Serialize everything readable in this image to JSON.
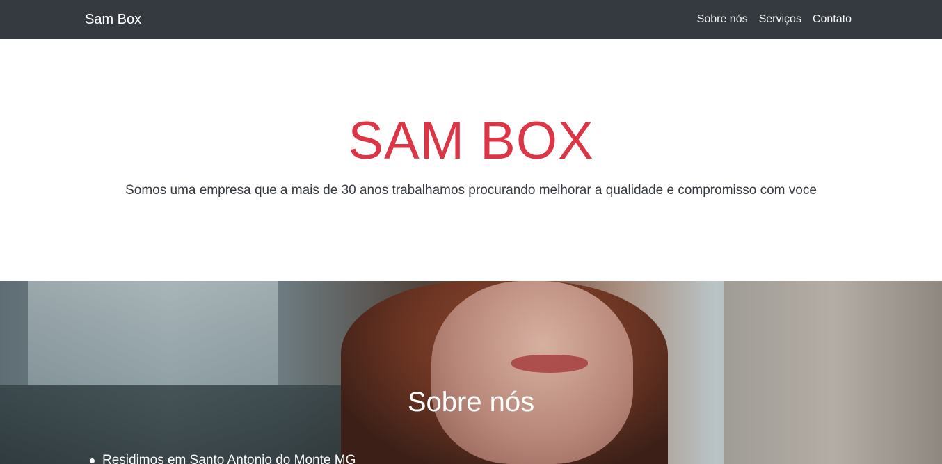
{
  "navbar": {
    "brand": "Sam Box",
    "links": [
      "Sobre nós",
      "Serviços",
      "Contato"
    ]
  },
  "hero": {
    "title": "SAM BOX",
    "subtitle": "Somos uma empresa que a mais de 30 anos trabalhamos procurando melhorar a qualidade e compromisso com voce"
  },
  "about": {
    "title": "Sobre nós",
    "items": [
      "Residimos em Santo Antonio do Monte MG"
    ]
  },
  "colors": {
    "navbar_bg": "#343a40",
    "accent": "#dc3545",
    "text": "#343a40"
  }
}
